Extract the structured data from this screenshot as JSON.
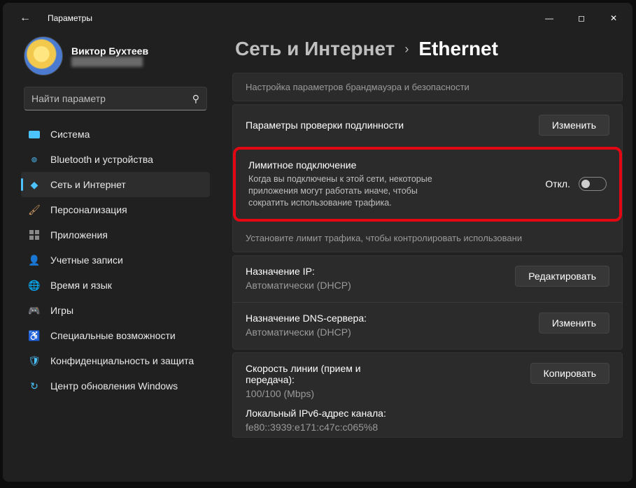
{
  "window": {
    "title": "Параметры"
  },
  "profile": {
    "name": "Виктор Бухтеев",
    "email": "████████████"
  },
  "search": {
    "placeholder": "Найти параметр"
  },
  "nav": {
    "system": "Система",
    "bluetooth": "Bluetooth и устройства",
    "network": "Сеть и Интернет",
    "personalization": "Персонализация",
    "apps": "Приложения",
    "accounts": "Учетные записи",
    "time": "Время и язык",
    "gaming": "Игры",
    "accessibility": "Специальные возможности",
    "privacy": "Конфиденциальность и защита",
    "update": "Центр обновления Windows"
  },
  "breadcrumb": {
    "parent": "Сеть и Интернет",
    "current": "Ethernet"
  },
  "rows": {
    "firewall": "Настройка параметров брандмауэра и безопасности",
    "auth_label": "Параметры проверки подлинности",
    "auth_btn": "Изменить",
    "metered_title": "Лимитное подключение",
    "metered_desc": "Когда вы подключены к этой сети, некоторые приложения могут работать иначе, чтобы сократить использование трафика.",
    "metered_state": "Откл.",
    "limit_hint": "Установите лимит трафика, чтобы контролировать использовани",
    "ip_label": "Назначение IP:",
    "ip_value": "Автоматически (DHCP)",
    "ip_btn": "Редактировать",
    "dns_label": "Назначение DNS-сервера:",
    "dns_value": "Автоматически (DHCP)",
    "dns_btn": "Изменить",
    "speed_label": "Скорость линии (прием и передача):",
    "speed_value": "100/100 (Mbps)",
    "copy_btn": "Копировать",
    "ipv6_label": "Локальный IPv6-адрес канала:",
    "ipv6_value": "fe80::3939:e171:c47c:c065%8"
  }
}
